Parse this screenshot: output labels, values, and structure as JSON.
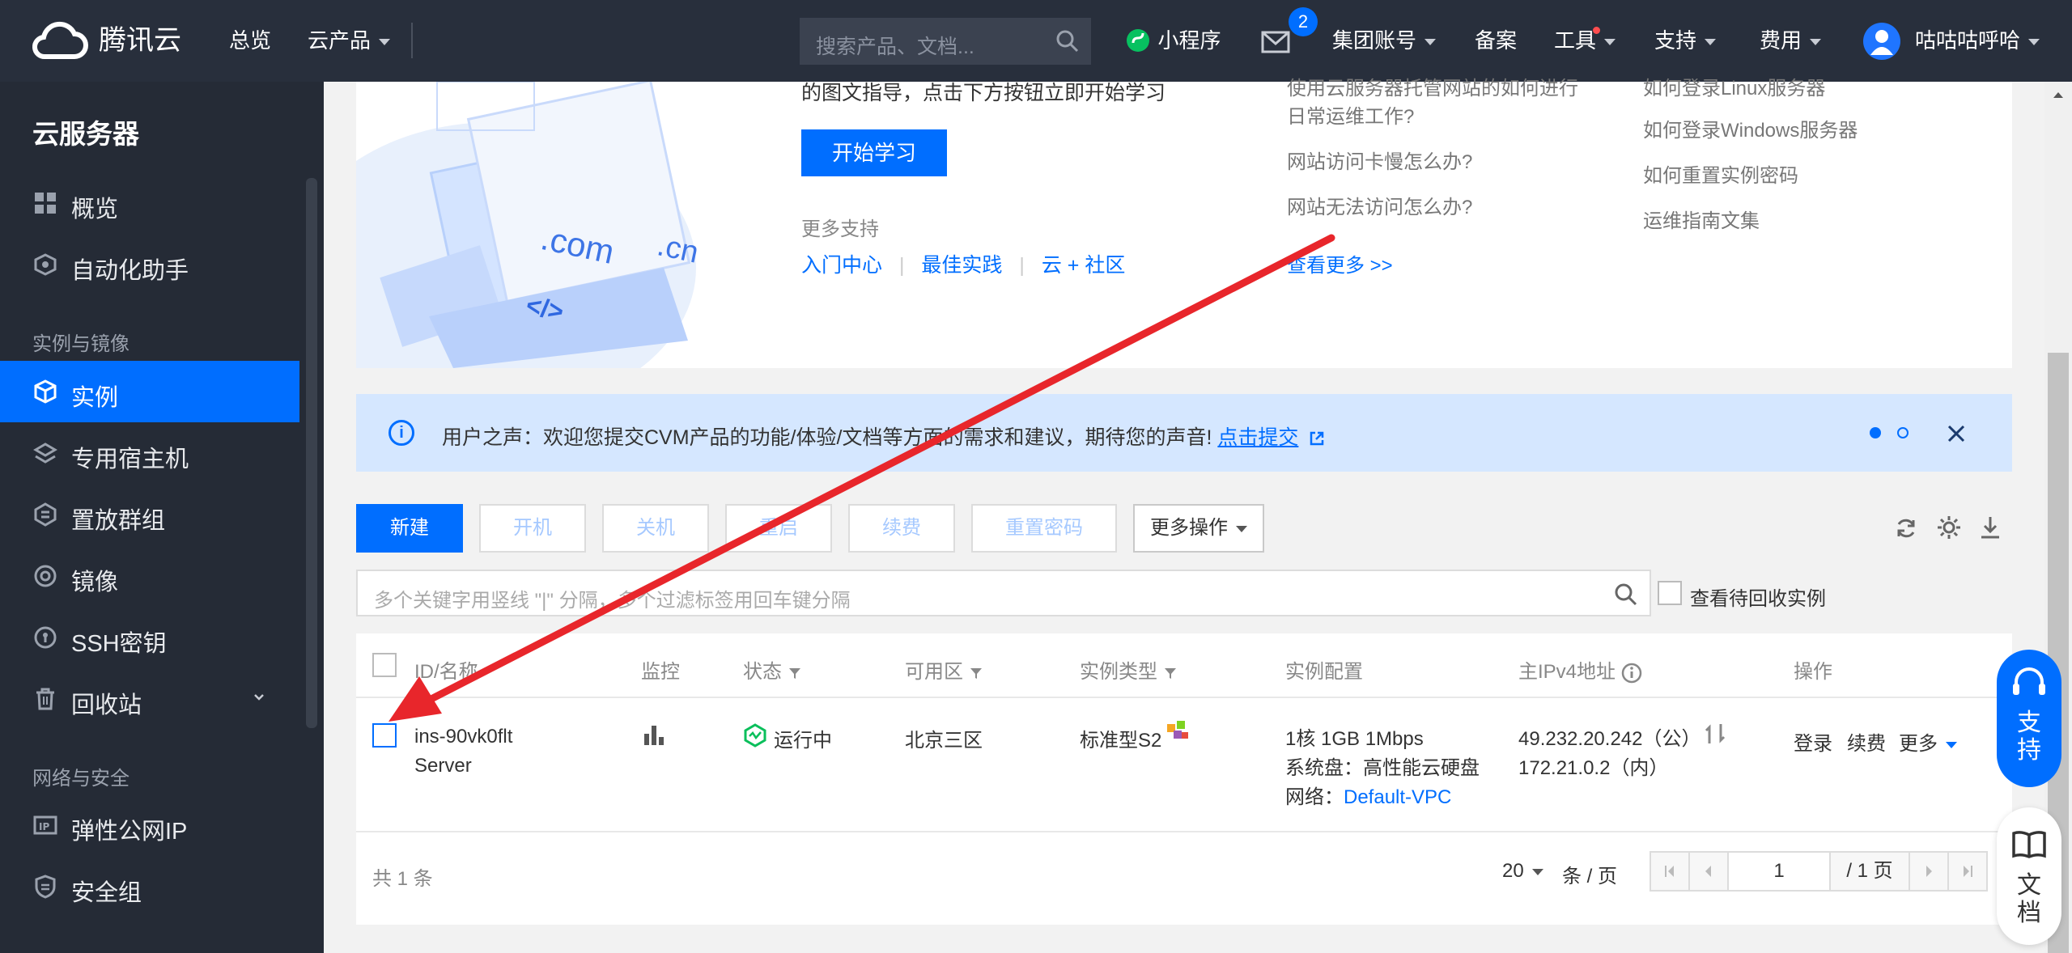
{
  "topnav": {
    "logo": "腾讯云",
    "overview": "总览",
    "products": "云产品",
    "search_placeholder": "搜索产品、文档...",
    "miniprogram": "小程序",
    "mail_badge": "2",
    "group_account": "集团账号",
    "filing": "备案",
    "tools": "工具",
    "support": "支持",
    "billing": "费用",
    "username": "咕咕咕呼哈"
  },
  "sidebar": {
    "title": "云服务器",
    "items_top": [
      {
        "label": "概览",
        "icon": "grid-icon"
      },
      {
        "label": "自动化助手",
        "icon": "automation-icon"
      }
    ],
    "group1": "实例与镜像",
    "items_mid": [
      {
        "label": "实例",
        "icon": "instance-icon"
      },
      {
        "label": "专用宿主机",
        "icon": "host-icon"
      },
      {
        "label": "置放群组",
        "icon": "placement-icon"
      },
      {
        "label": "镜像",
        "icon": "image-icon"
      },
      {
        "label": "SSH密钥",
        "icon": "ssh-key-icon"
      },
      {
        "label": "回收站",
        "icon": "recycle-icon"
      }
    ],
    "group2": "网络与安全",
    "items_bottom": [
      {
        "label": "弹性公网IP",
        "icon": "eip-icon"
      },
      {
        "label": "安全组",
        "icon": "security-group-icon"
      }
    ]
  },
  "banner": {
    "desc_cut": "的图文指导，点击下方按钮立即开始学习",
    "start_btn": "开始学习",
    "more_support": "更多支持",
    "links": [
      "入门中心",
      "最佳实践",
      "云 + 社区"
    ],
    "faq_col1": [
      "使用云服务器托管网站的如何进行",
      "日常运维工作?",
      "网站访问卡慢怎么办?",
      "网站无法访问怎么办?"
    ],
    "see_more": "查看更多 >>",
    "faq_col2": [
      "如何登录Linux服务器",
      "如何登录Windows服务器",
      "如何重置实例密码",
      "运维指南文集"
    ],
    "illus_com": ".com",
    "illus_cn": ".cn",
    "illus_code": "</>"
  },
  "notice": {
    "text": "用户之声：欢迎您提交CVM产品的功能/体验/文档等方面的需求和建议，期待您的声音!",
    "link": "点击提交"
  },
  "toolbar": {
    "new": "新建",
    "start": "开机",
    "stop": "关机",
    "restart": "重启",
    "renew": "续费",
    "reset_pwd": "重置密码",
    "more": "更多操作"
  },
  "filter": {
    "placeholder": "多个关键字用竖线 \"|\" 分隔，多个过滤标签用回车键分隔",
    "recycle_label": "查看待回收实例"
  },
  "table": {
    "headers": [
      "ID/名称",
      "监控",
      "状态",
      "可用区",
      "实例类型",
      "实例配置",
      "主IPv4地址",
      "操作"
    ],
    "row": {
      "id": "ins-90vk0flt",
      "name": "Server",
      "status": "运行中",
      "zone": "北京三区",
      "type": "标准型S2",
      "config1": "1核 1GB 1Mbps",
      "config2": "系统盘：高性能云硬盘",
      "config3_label": "网络：",
      "config3_value": "Default-VPC",
      "ip_public": "49.232.20.242（公）",
      "ip_private": "172.21.0.2（内）",
      "op_login": "登录",
      "op_renew": "续费",
      "op_more": "更多"
    },
    "total": "共 1 条",
    "page_size": "20",
    "per_page": "条 / 页",
    "page": "1",
    "total_pages": "/ 1 页"
  },
  "float": {
    "support": "支持",
    "docs": "文档"
  },
  "colors": {
    "primary": "#006eff",
    "nav_bg": "#282f3c",
    "sidebar_bg": "#252b36",
    "arrow": "#e8262b",
    "running": "#0abf5b"
  }
}
